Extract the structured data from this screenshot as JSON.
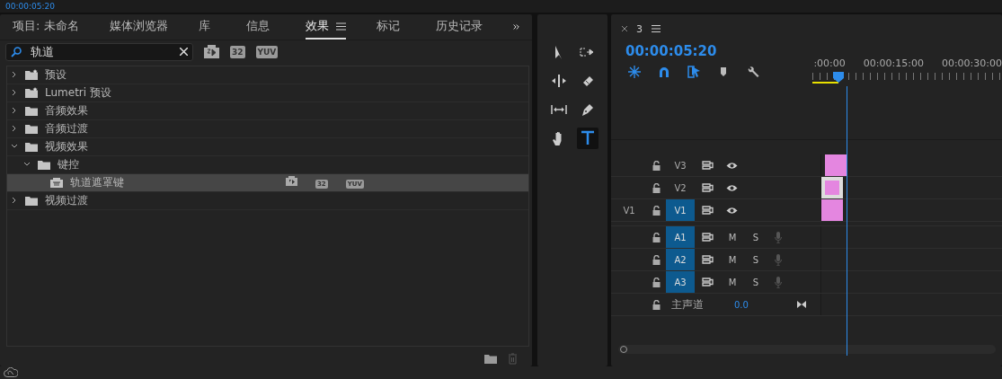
{
  "top_strip": {
    "timecode": "00:00:05:20"
  },
  "effects_panel": {
    "tabs": [
      {
        "label": "项目: 未命名",
        "selected": false,
        "menu": false
      },
      {
        "label": "媒体浏览器",
        "selected": false,
        "menu": false
      },
      {
        "label": "库",
        "selected": false,
        "menu": false
      },
      {
        "label": "信息",
        "selected": false,
        "menu": false
      },
      {
        "label": "效果",
        "selected": true,
        "menu": true
      },
      {
        "label": "标记",
        "selected": false,
        "menu": false
      },
      {
        "label": "历史记录",
        "selected": false,
        "menu": false
      }
    ],
    "search": {
      "value": "轨道"
    },
    "filters": [
      {
        "kind": "accel"
      },
      {
        "kind": "text",
        "text": "32"
      },
      {
        "kind": "text",
        "text": "YUV"
      }
    ],
    "tree": [
      {
        "label": "预设",
        "kind": "preset",
        "expanded": false,
        "selected": false
      },
      {
        "label": "Lumetri 预设",
        "kind": "preset",
        "expanded": false,
        "selected": false
      },
      {
        "label": "音频效果",
        "kind": "folder",
        "expanded": false,
        "selected": false
      },
      {
        "label": "音频过渡",
        "kind": "folder",
        "expanded": false,
        "selected": false
      },
      {
        "label": "视频效果",
        "kind": "folder",
        "expanded": true,
        "selected": false,
        "children": [
          {
            "label": "键控",
            "kind": "folder",
            "expanded": true,
            "selected": false,
            "children": [
              {
                "label": "轨道遮罩键",
                "kind": "effect",
                "selected": true,
                "badges": [
                  {
                    "kind": "accel"
                  },
                  {
                    "kind": "text",
                    "text": "32"
                  },
                  {
                    "kind": "text",
                    "text": "YUV"
                  }
                ]
              }
            ]
          }
        ]
      },
      {
        "label": "视频过渡",
        "kind": "folder",
        "expanded": false,
        "selected": false
      }
    ]
  },
  "tools": [
    {
      "kind": "select",
      "selected": false
    },
    {
      "kind": "track-select",
      "selected": false
    },
    {
      "kind": "ripple",
      "selected": false
    },
    {
      "kind": "razor",
      "selected": false
    },
    {
      "kind": "slip",
      "selected": false
    },
    {
      "kind": "pen",
      "selected": false
    },
    {
      "kind": "hand",
      "selected": false
    },
    {
      "kind": "type",
      "selected": true
    }
  ],
  "timeline": {
    "tab": {
      "label": "3"
    },
    "timecode": "00:00:05:20",
    "toggles": [
      {
        "kind": "nest",
        "on": true
      },
      {
        "kind": "snap",
        "on": true
      },
      {
        "kind": "linked",
        "on": true
      },
      {
        "kind": "marker",
        "on": false
      },
      {
        "kind": "settings",
        "on": false
      }
    ],
    "ruler": [
      ":00:00",
      "00:00:15:00",
      "00:00:30:00"
    ],
    "video_tracks": [
      {
        "name": "V3",
        "targeted": false,
        "clip": true,
        "clip_selected": false
      },
      {
        "name": "V2",
        "targeted": false,
        "clip": true,
        "clip_selected": true
      },
      {
        "source": "V1",
        "name": "V1",
        "targeted": true,
        "clip": true,
        "clip_selected": false
      }
    ],
    "audio_tracks": [
      {
        "name": "A1",
        "targeted": true,
        "mute": "M",
        "solo": "S"
      },
      {
        "name": "A2",
        "targeted": true,
        "mute": "M",
        "solo": "S"
      },
      {
        "name": "A3",
        "targeted": true,
        "mute": "M",
        "solo": "S"
      }
    ],
    "master": {
      "label": "主声道",
      "value": "0.0"
    }
  }
}
